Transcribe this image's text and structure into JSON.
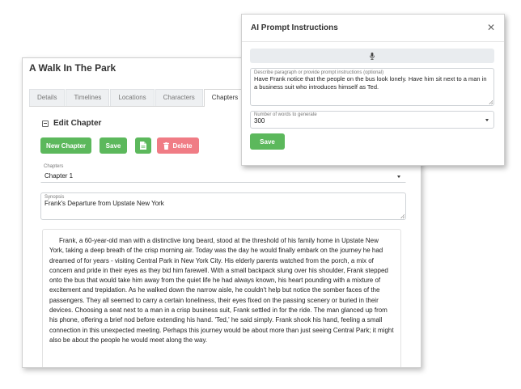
{
  "main_window": {
    "title": "A Walk In The Park",
    "tabs": [
      {
        "label": "Details",
        "active": false
      },
      {
        "label": "Timelines",
        "active": false
      },
      {
        "label": "Locations",
        "active": false
      },
      {
        "label": "Characters",
        "active": false
      },
      {
        "label": "Chapters",
        "active": true
      }
    ],
    "section_title": "Edit Chapter",
    "buttons": {
      "new_chapter": "New Chapter",
      "save": "Save",
      "export_icon": "file-icon",
      "delete": "Delete",
      "delete_icon": "trash-icon"
    },
    "chapters_field": {
      "label": "Chapters",
      "value": "Chapter 1"
    },
    "synopsis_field": {
      "label": "Synopsis",
      "value": "Frank's Departure from Upstate New York"
    },
    "chapter_text": "Frank, a 60-year-old man with a distinctive long beard, stood at the threshold of his family home in Upstate New York, taking a deep breath of the crisp morning air. Today was the day he would finally embark on the journey he had dreamed of for years - visiting Central Park in New York City. His elderly parents watched from the porch, a mix of concern and pride in their eyes as they bid him farewell. With a small backpack slung over his shoulder, Frank stepped onto the bus that would take him away from the quiet life he had always known, his heart pounding with a mixture of excitement and trepidation. As he walked down the narrow aisle, he couldn't help but notice the somber faces of the passengers. They all seemed to carry a certain loneliness, their eyes fixed on the passing scenery or buried in their devices. Choosing a seat next to a man in a crisp business suit, Frank settled in for the ride. The man glanced up from his phone, offering a brief nod before extending his hand. 'Ted,' he said simply. Frank shook his hand, feeling a small connection in this unexpected meeting. Perhaps this journey would be about more than just seeing Central Park; it might also be about the people he would meet along the way."
  },
  "dialog": {
    "title": "AI Prompt Instructions",
    "close_icon": "close-icon",
    "mic_icon": "microphone-icon",
    "prompt_field": {
      "label": "Describe paragraph or provide prompt instructions (optional)",
      "value": "Have Frank notice that the people on the bus look lonely. Have him sit next to a man in a business suit who introduces himself as Ted."
    },
    "words_field": {
      "label": "Number of words to generate",
      "value": "300"
    },
    "save_button": "Save"
  },
  "colors": {
    "green_button": "#5cb85c",
    "delete_button": "#f07c85",
    "mic_bar": "#e9ecef"
  }
}
